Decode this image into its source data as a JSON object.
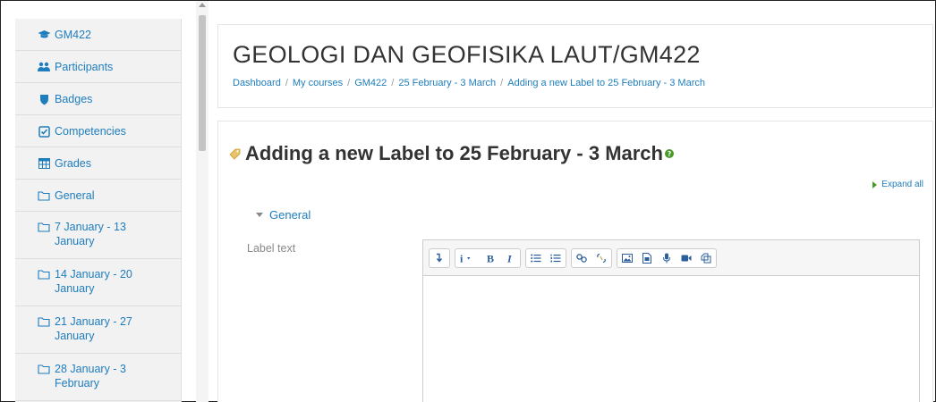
{
  "sidebar": {
    "items": [
      {
        "label": "GM422",
        "icon": "graduation-cap-icon"
      },
      {
        "label": "Participants",
        "icon": "users-icon"
      },
      {
        "label": "Badges",
        "icon": "shield-icon"
      },
      {
        "label": "Competencies",
        "icon": "checkbox-icon"
      },
      {
        "label": "Grades",
        "icon": "table-icon"
      },
      {
        "label": "General",
        "icon": "folder-icon"
      },
      {
        "label": "7 January - 13 January",
        "icon": "folder-icon"
      },
      {
        "label": "14 January - 20 January",
        "icon": "folder-icon"
      },
      {
        "label": "21 January - 27 January",
        "icon": "folder-icon"
      },
      {
        "label": "28 January - 3 February",
        "icon": "folder-icon"
      }
    ]
  },
  "header": {
    "title": "GEOLOGI DAN GEOFISIKA LAUT/GM422",
    "breadcrumb": [
      "Dashboard",
      "My courses",
      "GM422",
      "25 February - 3 March",
      "Adding a new Label to 25 February - 3 March"
    ],
    "separator": "/"
  },
  "main": {
    "heading": "Adding a new Label to 25 February - 3 March",
    "expand_all": "Expand all",
    "section": "General",
    "field_label": "Label text"
  },
  "colors": {
    "link": "#1e7dbd",
    "sidebar_bg": "#f2f2f2",
    "expand_triangle": "#4a9a2a"
  }
}
